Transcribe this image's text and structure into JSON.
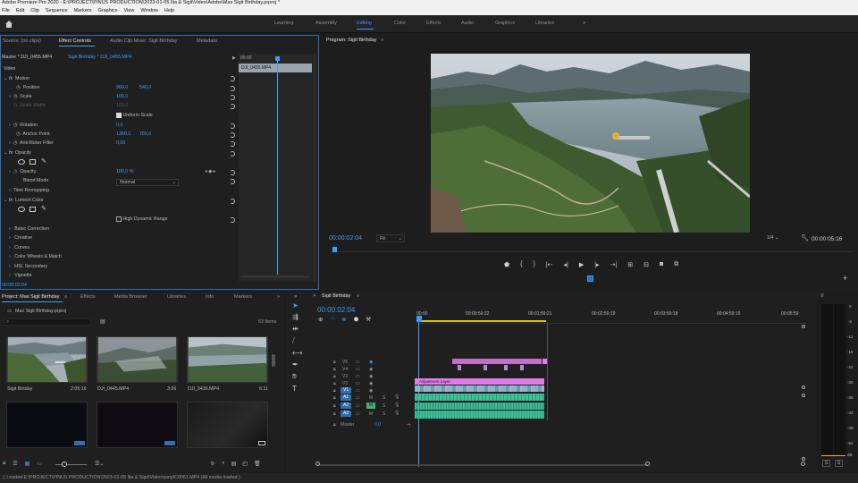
{
  "window": {
    "title": "Adobe Premiere Pro 2020 - E:\\PROJECT\\PINUS PRODUCTION\\2023-01-05 Ilia & Sigit\\Video\\Adobe\\Mas Sigit Birthday.prproj *"
  },
  "menu": [
    "File",
    "Edit",
    "Clip",
    "Sequence",
    "Markers",
    "Graphics",
    "View",
    "Window",
    "Help"
  ],
  "workspaces": [
    "Learning",
    "Assembly",
    "Editing",
    "Color",
    "Effects",
    "Audio",
    "Graphics",
    "Libraries"
  ],
  "workspace_more": "»",
  "source_panel": {
    "tabs": [
      "Source: (no clips)",
      "Effect Controls",
      "Audio Clip Mixer: Sigit Birthday",
      "Metadata"
    ],
    "master_label": "Master * DJI_0455.MP4",
    "sequence_label": "Sigit Birthday * DJI_0455.MP4",
    "clip_name": "DJI_0455.MP4",
    "mini_timecode": "00:00",
    "section_video": "Video",
    "motion": "Motion",
    "position_label": "Position",
    "position_x": "960,0",
    "position_y": "540,0",
    "scale_label": "Scale",
    "scale_value": "100,0",
    "scale_width_label": "Scale Width",
    "scale_width_value": "100,0",
    "uniform_scale": "Uniform Scale",
    "rotation_label": "Rotation",
    "rotation_value": "0,0",
    "anchor_label": "Anchor Point",
    "anchor_x": "1360,0",
    "anchor_y": "765,0",
    "antiflicker_label": "Anti-flicker Filter",
    "antiflicker_value": "0,00",
    "opacity": "Opacity",
    "opacity_label": "Opacity",
    "opacity_value": "100,0 %",
    "blend_label": "Blend Mode",
    "blend_value": "Normal",
    "time_remapping": "Time Remapping",
    "lumetri": "Lumetri Color",
    "hdr": "High Dynamic Range",
    "lumetri_sections": [
      "Basic Correction",
      "Creative",
      "Curves",
      "Color Wheels & Match",
      "HSL Secondary",
      "Vignette"
    ],
    "timecode": "00:00:02:04"
  },
  "program": {
    "title": "Program: Sigit Birthday",
    "timecode": "00:00:02:04",
    "fit": "Fit",
    "resolution": "1/4",
    "duration": "00:00:05:16"
  },
  "project": {
    "tabs": [
      "Project: Mas Sigit Birthday",
      "Effects",
      "Media Browser",
      "Libraries",
      "Info",
      "Markers"
    ],
    "file": "Mas Sigit Birthday.prproj",
    "item_count": "63 Items",
    "items": [
      {
        "name": "Sigit Birtday",
        "duration": "2:05:16"
      },
      {
        "name": "DJI_0445.MP4",
        "duration": "3:26"
      },
      {
        "name": "DJI_0436.MP4",
        "duration": "6:11"
      }
    ]
  },
  "timeline": {
    "tab": "Sigit Birthday",
    "timecode": "00:00:02:04",
    "ruler": [
      "00:00",
      "00:00:59:22",
      "00:01:59:21",
      "00:02:59:19",
      "00:03:59:18",
      "00:04:59:16",
      "00:05:59"
    ],
    "video_tracks": [
      "V5",
      "V4",
      "V3",
      "V2",
      "V1"
    ],
    "audio_tracks": [
      "A1",
      "A2",
      "A3"
    ],
    "adjustment_layer": "Adjustment Layer",
    "master": "Master",
    "master_value": "0,0"
  },
  "meter": {
    "scale": [
      "0",
      "-6",
      "-12",
      "-18",
      "-24",
      "-30",
      "-36",
      "-42",
      "-48",
      "-54",
      "dB"
    ],
    "solo": [
      "S",
      "S"
    ]
  },
  "status": {
    "text": "Loaded E:\\PROJECT\\PINUS PRODUCTION\\2023-01-05 Ilia & Sigit\\Video\\sony\\C0061.MP4 (All media loaded.)"
  },
  "colors": {
    "accent": "#3aa0ff",
    "playhead": "#2d8ceb",
    "video_clip": "#e17ce8",
    "audio_clip": "#3fbf9a",
    "work_area": "#e0c020"
  }
}
